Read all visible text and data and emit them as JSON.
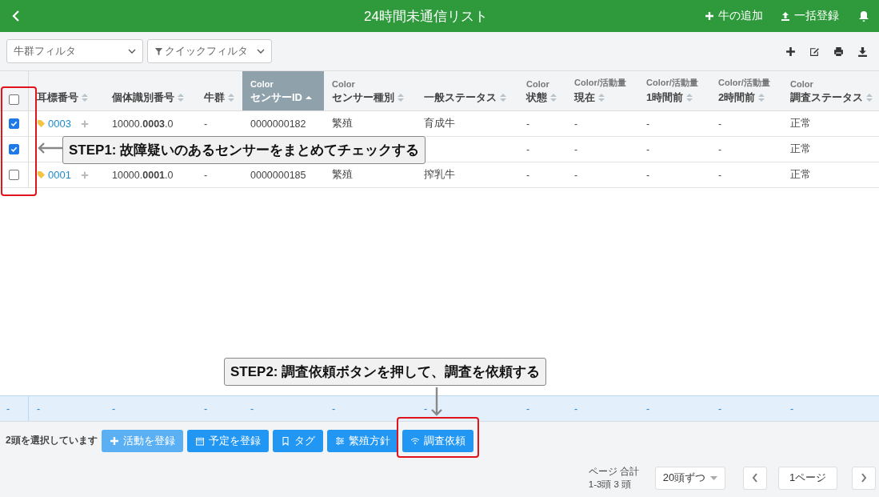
{
  "header": {
    "title": "24時間未通信リスト",
    "actions": [
      {
        "kind": "plus",
        "label": "牛の追加"
      },
      {
        "kind": "upload",
        "label": "一括登録"
      }
    ]
  },
  "filters": [
    {
      "kind": "plain",
      "label": "牛群フィルタ"
    },
    {
      "kind": "funnel",
      "label": "クイックフィルタ"
    }
  ],
  "toolbar_icons": [
    {
      "kind": "plus"
    },
    {
      "kind": "edit"
    },
    {
      "kind": "print"
    },
    {
      "kind": "download"
    }
  ],
  "table": {
    "all_checked": false,
    "columns": [
      {
        "label": "耳標番号",
        "sorted": false
      },
      {
        "label": "個体識別番号",
        "sorted": false
      },
      {
        "label": "牛群",
        "sorted": false
      },
      {
        "top": "Color",
        "label": "センサーID",
        "sorted": true
      },
      {
        "top": "Color",
        "label": "センサー種別",
        "sorted": false
      },
      {
        "label": "一般ステータス",
        "sorted": false
      },
      {
        "top": "Color",
        "label": "状態",
        "sorted": false
      },
      {
        "top": "Color/活動量",
        "label": "現在",
        "sorted": false
      },
      {
        "top": "Color/活動量",
        "label": "1時間前",
        "sorted": false
      },
      {
        "top": "Color/活動量",
        "label": "2時間前",
        "sorted": false
      },
      {
        "top": "Color",
        "label": "調査ステータス",
        "sorted": false
      }
    ],
    "rows": [
      {
        "checked": true,
        "ear_tag": "0003",
        "id_number": "10000.**0003**.0",
        "herd": "-",
        "sensor_id": "0000000182",
        "sensor_type": "繁殖",
        "general_status": "育成牛",
        "state": "-",
        "current": "-",
        "hour_1": "-",
        "hour_2": "-",
        "survey_status": "正常"
      },
      {
        "checked": true,
        "state": "-",
        "current": "-",
        "hour_1": "-",
        "hour_2": "-",
        "survey_status": "正常"
      },
      {
        "checked": false,
        "ear_tag": "0001",
        "id_number": "10000.**0001**.0",
        "herd": "-",
        "sensor_id": "0000000185",
        "sensor_type": "繁殖",
        "general_status": "搾乳牛",
        "state": "-",
        "current": "-",
        "hour_1": "-",
        "hour_2": "-",
        "survey_status": "正常"
      }
    ],
    "summary": [
      "-",
      "-",
      "-",
      "-",
      "-",
      "-",
      "-",
      "-",
      "-",
      "-",
      "-",
      "-"
    ]
  },
  "selection": {
    "text": "2頭を選択しています",
    "buttons": [
      {
        "kind": "plus",
        "label": "活動を登録",
        "hovered": true
      },
      {
        "kind": "calendar",
        "label": "予定を登録",
        "hovered": false
      },
      {
        "kind": "bookmark",
        "label": "タグ",
        "hovered": false
      },
      {
        "kind": "sliders",
        "label": "繁殖方針",
        "hovered": false
      },
      {
        "kind": "wifi",
        "label": "調査依頼",
        "hovered": false
      }
    ]
  },
  "pagination": {
    "page_label": "ページ 合計",
    "range": "1-3頭 3 頭",
    "per_page": "20頭ずつ",
    "page": "1ページ"
  },
  "callouts": [
    {
      "step": "STEP1: 故障疑いのあるセンサーをまとめてチェックする"
    },
    {
      "step": "STEP2: 調査依頼ボタンを押して、調査を依頼する"
    }
  ]
}
